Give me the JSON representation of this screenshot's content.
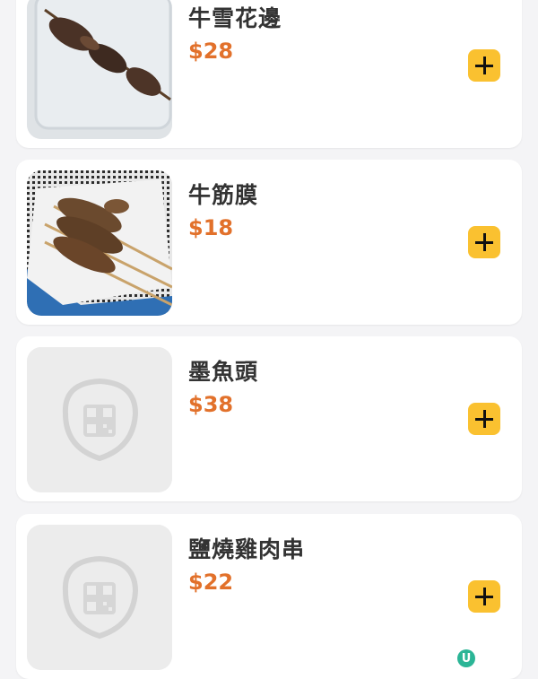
{
  "menu": {
    "items": [
      {
        "name": "牛雪花邊",
        "price": "$28",
        "image": "grilled-beef-skewer-photo"
      },
      {
        "name": "牛筋膜",
        "price": "$18",
        "image": "beef-tendon-skewers-photo"
      },
      {
        "name": "墨魚頭",
        "price": "$38",
        "image": "placeholder-icon"
      },
      {
        "name": "鹽燒雞肉串",
        "price": "$22",
        "image": "placeholder-icon"
      }
    ]
  },
  "colors": {
    "price": "#e2712b",
    "add_button": "#fac130",
    "card_bg": "#ffffff",
    "page_bg": "#f4f4f6"
  },
  "watermark": {
    "logo_text": "U"
  }
}
